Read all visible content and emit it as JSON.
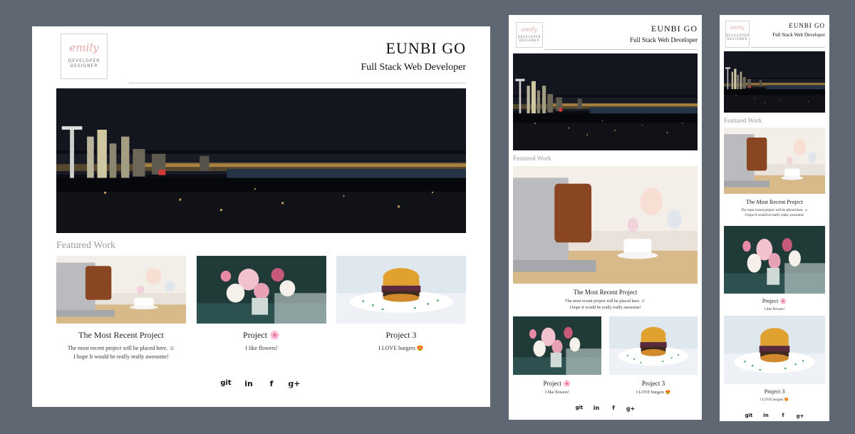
{
  "logo": {
    "script": "emily",
    "line1": "DEVELOPER",
    "line2": "DESIGNER"
  },
  "header": {
    "name": "EUNBI GO",
    "role": "Full Stack Web Developer"
  },
  "featured": {
    "heading": "Featured Work"
  },
  "projects": [
    {
      "title": "The Most Recent Project",
      "line1": "The most recent project will be placed here. ☺",
      "line2": "I hope It would be really really awesome!",
      "image": "laptop-coffee-photo"
    },
    {
      "title": "Project 🌸",
      "line1": "I like flowers!",
      "line2": "",
      "image": "peony-flowers-photo"
    },
    {
      "title": "Project 3",
      "line1": "I LOVE burgers 😍",
      "line2": "",
      "image": "burger-photo"
    }
  ],
  "social": {
    "items": [
      {
        "icon": "git-icon",
        "glyph": "git"
      },
      {
        "icon": "linkedin-icon",
        "glyph": "in"
      },
      {
        "icon": "facebook-icon",
        "glyph": "f"
      },
      {
        "icon": "google-plus-icon",
        "glyph": "g+"
      }
    ]
  },
  "colors": {
    "backdrop": "#5f6872",
    "accent_script": "#e3a6a8",
    "section_heading": "#9a9a9a"
  }
}
